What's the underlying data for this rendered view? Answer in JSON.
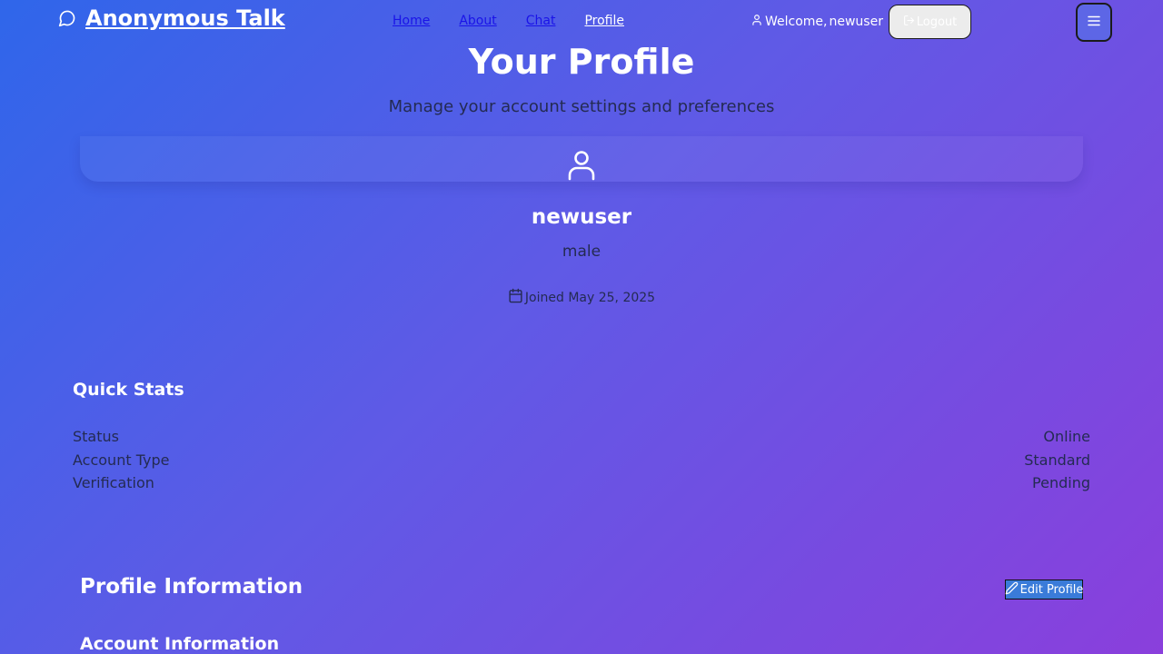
{
  "app": {
    "title": "Anonymous Talk",
    "brand_icon": "message-circle-icon"
  },
  "nav": {
    "links": [
      {
        "label": "Home",
        "active": false
      },
      {
        "label": "About",
        "active": false
      },
      {
        "label": "Chat",
        "active": false
      },
      {
        "label": "Profile",
        "active": true
      }
    ],
    "welcome_prefix": "Welcome,",
    "welcome_user": "newuser",
    "logout_label": "Logout",
    "icons": {
      "user": "user-icon",
      "logout": "log-out-icon",
      "menu": "menu-icon"
    }
  },
  "header": {
    "title": "Your Profile",
    "subtitle": "Manage your account settings and preferences"
  },
  "profile": {
    "avatar_icon": "user-icon",
    "username": "newuser",
    "gender": "male",
    "joined": "Joined May 25, 2025",
    "joined_icon": "calendar-icon"
  },
  "quick_stats": {
    "title": "Quick Stats",
    "rows": [
      {
        "label": "Status",
        "value": "Online"
      },
      {
        "label": "Account Type",
        "value": "Standard"
      },
      {
        "label": "Verification",
        "value": "Pending"
      }
    ]
  },
  "profile_information": {
    "title": "Profile Information",
    "edit_label": "Edit Profile",
    "edit_icon": "pencil-icon",
    "account_section_title": "Account Information"
  },
  "colors": {
    "gradient_start": "#2f66ea",
    "gradient_end": "#8a3fdc",
    "muted_text": "#242b52",
    "nav_link": "#1a13e8",
    "edit_button": "#3a7bd9"
  }
}
